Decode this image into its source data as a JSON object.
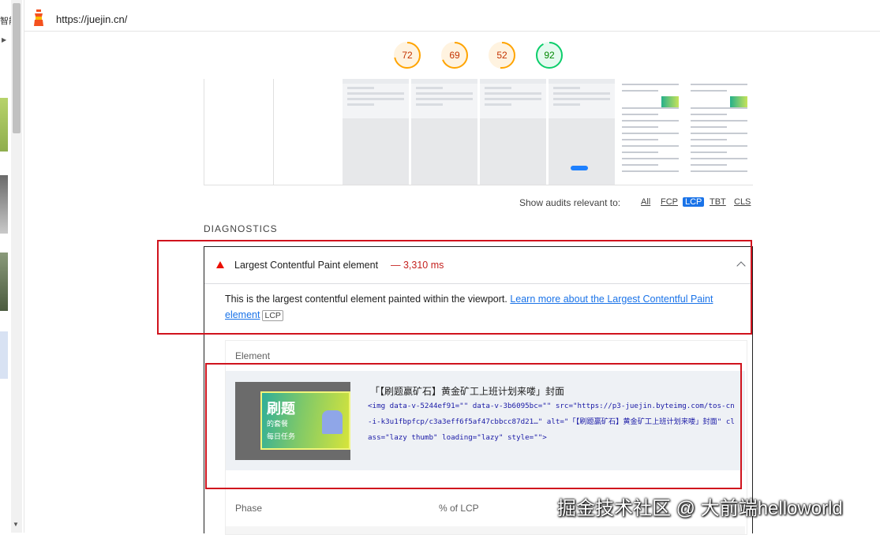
{
  "sidebar_fragment": {
    "text": "智能"
  },
  "urlbar": {
    "url": "https://juejin.cn/",
    "favicon": "juejin-lighthouse-icon"
  },
  "scores": [
    {
      "value": "72",
      "status": "average",
      "color": "#ffa400"
    },
    {
      "value": "69",
      "status": "average",
      "color": "#ffa400"
    },
    {
      "value": "52",
      "status": "average",
      "color": "#ffa400"
    },
    {
      "value": "92",
      "status": "pass",
      "color": "#0cce6b"
    }
  ],
  "filter": {
    "label": "Show audits relevant to:",
    "options": [
      "All",
      "FCP",
      "LCP",
      "TBT",
      "CLS"
    ],
    "active": "LCP"
  },
  "diagnostics": {
    "section_title": "DIAGNOSTICS",
    "audit": {
      "title": "Largest Contentful Paint element",
      "value": "— 3,310 ms",
      "description": "This is the largest contentful element painted within the viewport.",
      "link_text": "Learn more about the Largest Contentful Paint element",
      "tag": "LCP"
    },
    "table": {
      "header": "Element",
      "element_name": "「【刷题赢矿石】黄金矿工上班计划来喽」封面",
      "element_code": "<img data-v-5244ef91=\"\" data-v-3b6095bc=\"\" src=\"https://p3-juejin.byteimg.com/tos-cn-i-k3u1fbpfcp/c3a3eff6f5af47cbbcc87d21…\" alt=\"「【刷题赢矿石】黄金矿工上班计划来喽」封面\" class=\"lazy thumb\" loading=\"lazy\" style=\"\">",
      "thumbnail_text": [
        "刷题",
        "的套餐",
        "每日任务"
      ],
      "phase_header": "Phase",
      "pct_header": "% of LCP"
    }
  },
  "watermark": "掘金技术社区 @ 大前端helloworld",
  "colors": {
    "annotation_red": "#d0131d",
    "link_blue": "#1a73e8",
    "fail_red": "#eb0f00"
  }
}
